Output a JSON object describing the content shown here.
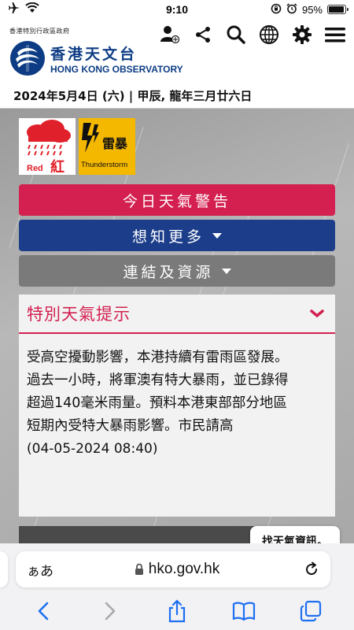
{
  "status_bar": {
    "time": "9:10",
    "battery_percent_label": "95%",
    "battery_level": 0.95,
    "icons": [
      "airplane-icon",
      "wifi-icon",
      "rotation-lock-icon",
      "alarm-icon",
      "battery-icon"
    ]
  },
  "header": {
    "logo_small_text": "香港特別行政區政府",
    "logo_cn": "香港天文台",
    "logo_en": "HONG KONG OBSERVATORY",
    "icons": [
      "user-settings-icon",
      "share-icon",
      "search-icon",
      "globe-icon",
      "gear-icon",
      "menu-icon"
    ]
  },
  "date_line": "2024年5月4日 (六) | 甲辰, 龍年三月廿六日",
  "warnings": {
    "rainstorm": {
      "label_en": "Red",
      "label_cn": "紅",
      "color": "#e0202a"
    },
    "thunderstorm": {
      "label_cn": "雷暴",
      "label_en": "Thunderstorm",
      "color": "#f5b800"
    }
  },
  "menu": {
    "today_warnings": "今日天氣警告",
    "want_to_know": "想知更多",
    "links_resources": "連結及資源"
  },
  "notice": {
    "title": "特別天氣提示",
    "lines": [
      "受高空擾動影響，本港持續有雷雨區發展。",
      "過去一小時，將軍澳有特大暴雨，並已錄得",
      "超過140毫米雨量。預料本港東部部分地區",
      "短期內受特大暴雨影響。市民請高"
    ],
    "timestamp": "(04-05-2024 08:40)"
  },
  "assistant": {
    "tooltip": "找天氣資訊。"
  },
  "browser": {
    "aa_label": "ぁあ",
    "url": "hko.gov.hk",
    "toolbar_icons": [
      "back-icon",
      "forward-icon",
      "share-icon",
      "bookmarks-icon",
      "tabs-icon"
    ]
  },
  "colors": {
    "brand_blue": "#0d3c84",
    "warning_red": "#d32050",
    "more_blue": "#1c3e8a",
    "links_grey": "#7a7a7a"
  }
}
